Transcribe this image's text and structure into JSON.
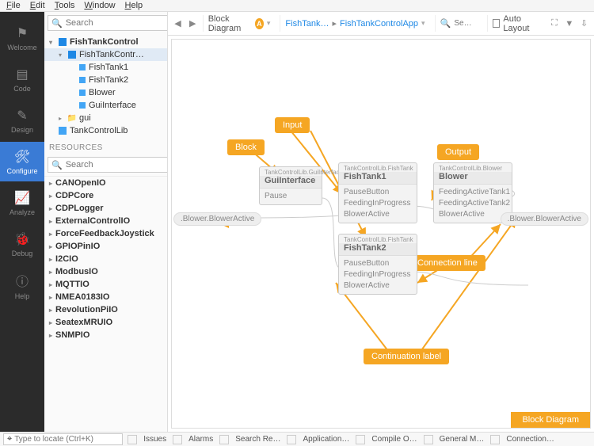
{
  "menu": {
    "file": "File",
    "edit": "Edit",
    "tools": "Tools",
    "window": "Window",
    "help": "Help"
  },
  "activity": {
    "welcome": "Welcome",
    "code": "Code",
    "design": "Design",
    "configure": "Configure",
    "analyze": "Analyze",
    "debug": "Debug",
    "help": "Help"
  },
  "side": {
    "search_placeholder": "Search",
    "tree": {
      "root": "FishTankControl",
      "app": "FishTankContr…",
      "tank1": "FishTank1",
      "tank2": "FishTank2",
      "blower": "Blower",
      "gui_interface": "GuiInterface",
      "gui": "gui",
      "lib": "TankControlLib"
    },
    "resources_hdr": "RESOURCES",
    "res_search_placeholder": "Search",
    "resources": [
      "CANOpenIO",
      "CDPCore",
      "CDPLogger",
      "ExternalControlIO",
      "ForceFeedbackJoystick",
      "GPIOPinIO",
      "I2CIO",
      "ModbusIO",
      "MQTTIO",
      "NMEA0183IO",
      "RevolutionPiIO",
      "SeatexMRUIO",
      "SNMPIO"
    ]
  },
  "toolbar": {
    "mode": "Block Diagram",
    "crumb1": "FishTank…",
    "crumb2": "FishTankControlApp",
    "search_placeholder": "Se…",
    "auto_layout": "Auto Layout"
  },
  "canvas": {
    "tags": {
      "block": "Block",
      "input": "Input",
      "output": "Output",
      "conn": "Connection line",
      "cont": "Continuation label"
    },
    "nodes": {
      "gui": {
        "hdr": "TankControlLib.GuiInterface",
        "title": "GuiInterface",
        "ports": [
          "Pause"
        ]
      },
      "t1": {
        "hdr": "TankControlLib.FishTank",
        "title": "FishTank1",
        "ports": [
          "PauseButton",
          "FeedingInProgress",
          "BlowerActive"
        ]
      },
      "t2": {
        "hdr": "TankControlLib.FishTank",
        "title": "FishTank2",
        "ports": [
          "PauseButton",
          "FeedingInProgress",
          "BlowerActive"
        ]
      },
      "bl": {
        "hdr": "TankControlLib.Blower",
        "title": "Blower",
        "ports": [
          "FeedingActiveTank1",
          "FeedingActiveTank2",
          "BlowerActive"
        ]
      }
    },
    "cont_left": ".Blower.BlowerActive",
    "cont_right": ".Blower.BlowerActive",
    "footer": "Block Diagram"
  },
  "status": {
    "locate_placeholder": "Type to locate (Ctrl+K)",
    "tabs": [
      "Issues",
      "Alarms",
      "Search Re…",
      "Application…",
      "Compile O…",
      "General M…",
      "Connection…"
    ]
  }
}
